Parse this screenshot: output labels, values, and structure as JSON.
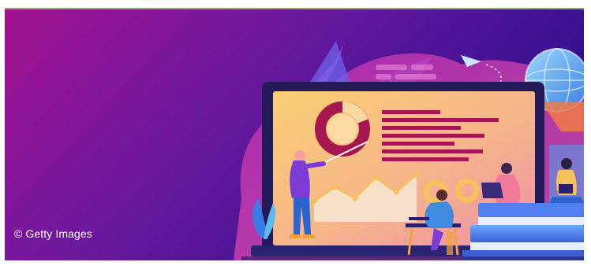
{
  "image": {
    "credit_text": "© Getty Images",
    "palette": {
      "bg_left": "#a3128f",
      "bg_mid": "#5b1a9e",
      "bg_right": "#2b0f8f",
      "screen_warm": "#f7c86a",
      "screen_pink": "#f3a98e",
      "bar_color": "#a7174f",
      "laptop_frame": "#241a5a",
      "accent_blue": "#62b9f0",
      "figure_purple": "#7d3bd6",
      "figure_blue": "#2b63d1"
    }
  }
}
